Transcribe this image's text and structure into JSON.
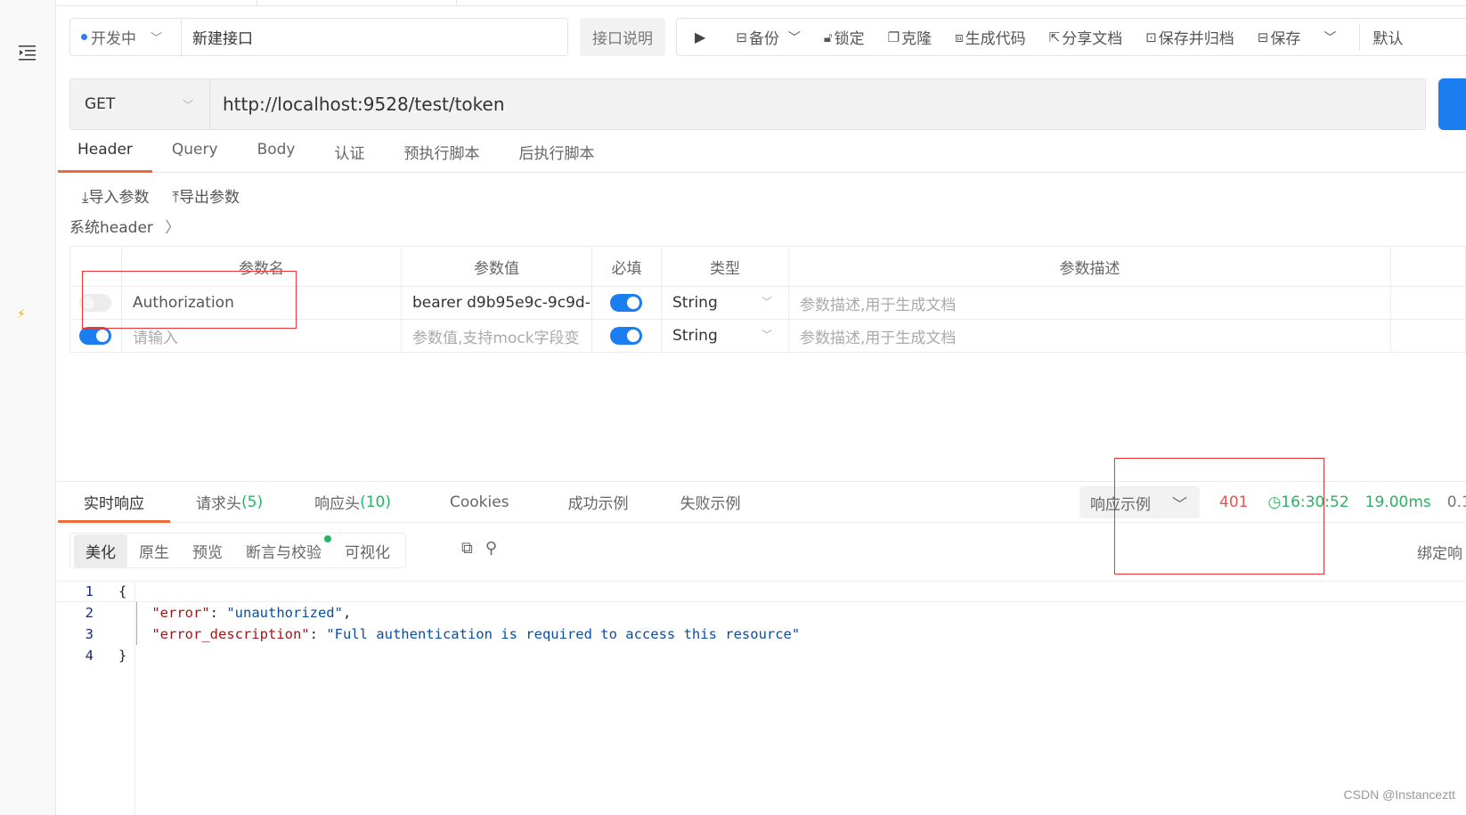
{
  "status": {
    "label": "开发中",
    "color": "#2a7ff0"
  },
  "api_name": {
    "value": "新建接口"
  },
  "doc_button": "接口说明",
  "toolbar": {
    "run_icon": "play-icon",
    "items": [
      {
        "icon": "backup-icon",
        "label": "备份"
      },
      {
        "icon": "lock-icon",
        "label": "锁定"
      },
      {
        "icon": "clone-icon",
        "label": "克隆"
      },
      {
        "icon": "code-icon",
        "label": "生成代码"
      },
      {
        "icon": "share-icon",
        "label": "分享文档"
      },
      {
        "icon": "archive-icon",
        "label": "保存并归档"
      },
      {
        "icon": "save-icon",
        "label": "保存"
      }
    ],
    "env_label": "默认"
  },
  "request": {
    "method": "GET",
    "url": "http://localhost:9528/test/token"
  },
  "request_tabs": [
    "Header",
    "Query",
    "Body",
    "认证",
    "预执行脚本",
    "后执行脚本"
  ],
  "active_request_tab": "Header",
  "param_actions": {
    "import": "导入参数",
    "export": "导出参数"
  },
  "system_header": "系统header",
  "params_table": {
    "columns": [
      "参数名",
      "参数值",
      "必填",
      "类型",
      "参数描述"
    ],
    "rows": [
      {
        "enabled": false,
        "name": "Authorization",
        "value": "bearer d9b95e9c-9c9d-",
        "required": true,
        "type": "String",
        "description_placeholder": "参数描述,用于生成文档"
      },
      {
        "enabled": true,
        "name_placeholder": "请输入",
        "value_placeholder": "参数值,支持mock字段变",
        "required": true,
        "type": "String",
        "description_placeholder": "参数描述,用于生成文档"
      }
    ]
  },
  "response_tabs": [
    {
      "label": "实时响应",
      "count": ""
    },
    {
      "label": "请求头",
      "count": "(5)"
    },
    {
      "label": "响应头",
      "count": "(10)"
    },
    {
      "label": "Cookies",
      "count": ""
    },
    {
      "label": "成功示例",
      "count": ""
    },
    {
      "label": "失败示例",
      "count": ""
    }
  ],
  "response_meta": {
    "example_select": "响应示例",
    "status_code": "401",
    "time": "16:30:52",
    "duration": "19.00ms",
    "size": "0.1"
  },
  "view_tabs": [
    "美化",
    "原生",
    "预览",
    "断言与校验",
    "可视化"
  ],
  "bind_response": "绑定响",
  "response_body": {
    "lines": [
      {
        "n": "1",
        "parts": [
          [
            "",
            "{"
          ]
        ]
      },
      {
        "n": "2",
        "parts": [
          [
            "",
            "    "
          ],
          [
            "key",
            "\"error\""
          ],
          [
            "",
            ": "
          ],
          [
            "str",
            "\"unauthorized\""
          ],
          [
            "",
            ","
          ]
        ]
      },
      {
        "n": "3",
        "parts": [
          [
            "",
            "    "
          ],
          [
            "key",
            "\"error_description\""
          ],
          [
            "",
            ": "
          ],
          [
            "str",
            "\"Full authentication is required to access this resource\""
          ]
        ]
      },
      {
        "n": "4",
        "parts": [
          [
            "",
            "}"
          ]
        ]
      }
    ]
  },
  "watermark": "CSDN @Instanceztt"
}
